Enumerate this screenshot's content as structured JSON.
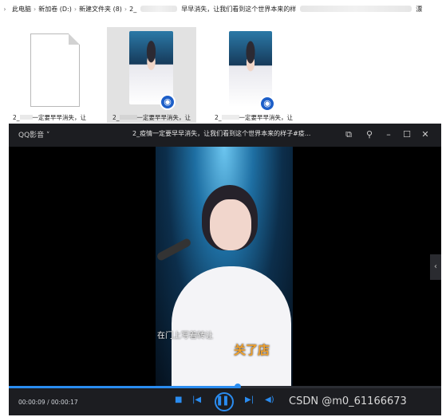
{
  "breadcrumb": [
    "此电脑",
    "新加卷 (D:)",
    "新建文件夹 (8)",
    "2_",
    "早早消失，让我们看到这个世界本来的样",
    "漂"
  ],
  "files": [
    {
      "caption": "2_",
      "caption_rest": "一定要早早消失，让",
      "icon": "blank-file-icon"
    },
    {
      "caption": "2_",
      "caption_rest": "一定要早早消失，让",
      "icon": "video-thumbnail"
    },
    {
      "caption": "2_",
      "caption_rest": "一定要早早消失，让",
      "icon": "video-thumbnail"
    }
  ],
  "player": {
    "app_name": "QQ影音",
    "title": "2_疫情一定要早早消失，让我们看到这个世界本来的样子#疫...",
    "subtitle_line1": "在门上写着转让",
    "subtitle_line2": "关了店",
    "time": "00:00:09 / 00:00:17",
    "progress": 0.53,
    "accent": "#2a8cf0"
  },
  "watermark": "CSDN @m0_61166673"
}
